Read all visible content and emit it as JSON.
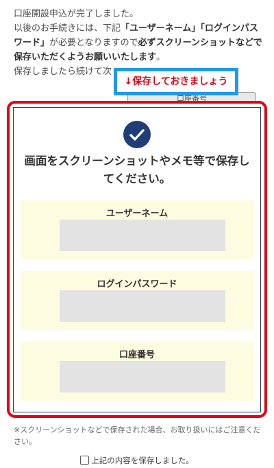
{
  "intro": {
    "line1": "口座開設申込が完了しました。",
    "line2_prefix": "以後のお手続きには、下記",
    "line2_bold": "「ユーザーネーム」「ログインパスワード」",
    "line2_mid": "が必要となりますので",
    "line2_bold2": "必ずスクリーンショットなどで保存いただくようお願いいたします",
    "line2_suffix": "。",
    "line3": "保存しましたら続けて次"
  },
  "behind_button_label": "口座番号",
  "callout_text": "↓保存しておきましょう",
  "panel": {
    "heading": "画面をスクリーンショットやメモ等で保存してください。",
    "cards": [
      {
        "label": "ユーザーネーム",
        "value": ""
      },
      {
        "label": "ログインパスワード",
        "value": ""
      },
      {
        "label": "口座番号",
        "value": ""
      }
    ]
  },
  "note": "※スクリーンショットなどで保存された場合、お取り扱いにはご注意ください。",
  "confirm_label": "上記の内容を保存しました。",
  "colors": {
    "accent_red": "#e60012",
    "callout_blue": "#1e9be6",
    "navy": "#1f3e78",
    "card_bg": "#fefce0"
  }
}
